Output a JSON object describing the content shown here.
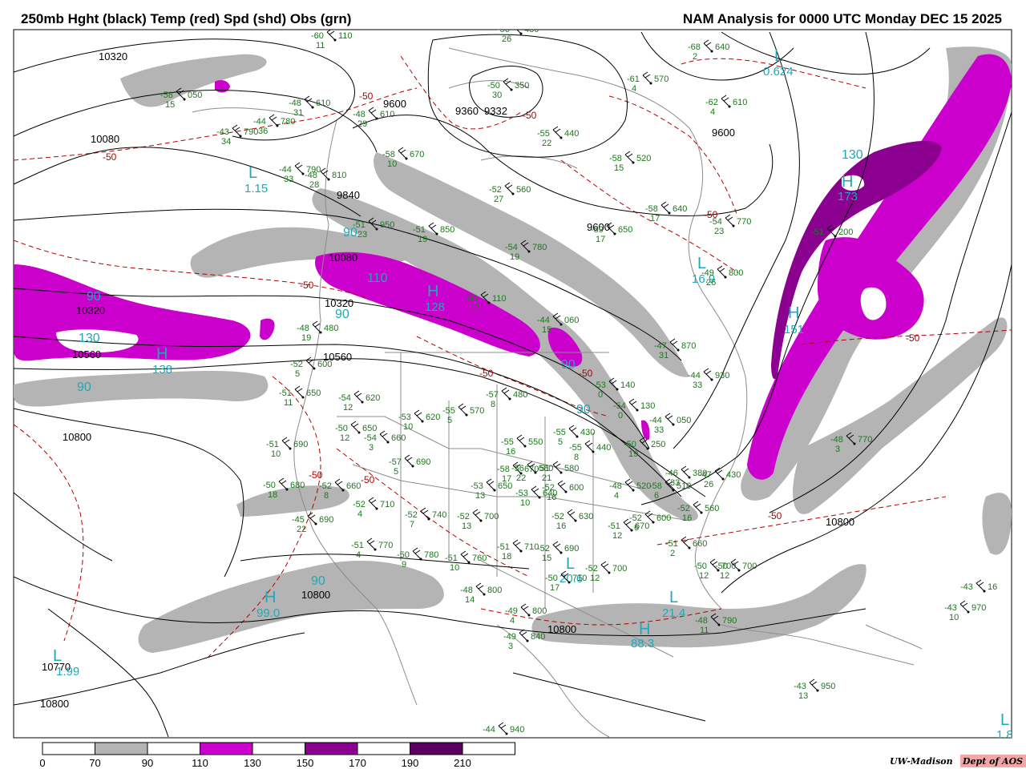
{
  "header": {
    "left_title": "250mb Hght (black) Temp (red) Spd (shd) Obs (grn)",
    "right_title": "NAM Analysis for 0000 UTC Monday  DEC 15 2025"
  },
  "colors": {
    "speed_70_90": "#b4b4b4",
    "speed_110_130": "#cc00cc",
    "speed_150_170": "#8c0090",
    "speed_190_210": "#5a0060",
    "height_contour": "#000000",
    "temperature_contour": "#b40000",
    "observations": "#1a7a1a",
    "center_labels": "#20a8b8",
    "geography": "#8c8c8c"
  },
  "height_labels": [
    "10320",
    "10080",
    "9840",
    "9600",
    "9360",
    "9332",
    "9600",
    "9600",
    "10080",
    "10320",
    "10560",
    "10800",
    "10320",
    "10560",
    "10800",
    "10800",
    "10770",
    "10800",
    "10800"
  ],
  "temp_labels": [
    "-50",
    "-50",
    "-50",
    "-50",
    "-50",
    "-50",
    "-50",
    "-50",
    "-50",
    "-50",
    "-50"
  ],
  "centers": [
    {
      "letter": "H",
      "value": "173"
    },
    {
      "letter": "H",
      "value": "128"
    },
    {
      "letter": "H",
      "value": "138"
    },
    {
      "letter": "H",
      "value": "99.0"
    },
    {
      "letter": "H",
      "value": "88.3"
    },
    {
      "letter": "H",
      "value": "151"
    },
    {
      "letter": "L",
      "value": "1.15"
    },
    {
      "letter": "L",
      "value": "0.624"
    },
    {
      "letter": "L",
      "value": "16.9"
    },
    {
      "letter": "L",
      "value": "21.4"
    },
    {
      "letter": "L",
      "value": "20.6"
    },
    {
      "letter": "L",
      "value": "1.99"
    },
    {
      "letter": "L",
      "value": "1.8"
    }
  ],
  "speed_labels": [
    "90",
    "90",
    "130",
    "90",
    "90",
    "90",
    "90",
    "130",
    "90",
    "110"
  ],
  "observations": [
    {
      "temp": "-60",
      "hgt": "110",
      "dpd": "11"
    },
    {
      "temp": "-56",
      "hgt": "430",
      "dpd": "26"
    },
    {
      "temp": "-58",
      "hgt": "050",
      "dpd": "15"
    },
    {
      "temp": "-48",
      "hgt": "610",
      "dpd": "31"
    },
    {
      "temp": "-44",
      "hgt": "780",
      "dpd": "36"
    },
    {
      "temp": "-43",
      "hgt": "790",
      "dpd": "34"
    },
    {
      "temp": "-48",
      "hgt": "610",
      "dpd": "29"
    },
    {
      "temp": "-50",
      "hgt": "350",
      "dpd": "30"
    },
    {
      "temp": "-68",
      "hgt": "640",
      "dpd": "2"
    },
    {
      "temp": "-61",
      "hgt": "570",
      "dpd": "4"
    },
    {
      "temp": "-62",
      "hgt": "610",
      "dpd": "4"
    },
    {
      "temp": "-55",
      "hgt": "440",
      "dpd": "22"
    },
    {
      "temp": "-58",
      "hgt": "670",
      "dpd": "10"
    },
    {
      "temp": "-58",
      "hgt": "520",
      "dpd": "15"
    },
    {
      "temp": "-44",
      "hgt": "790",
      "dpd": "33"
    },
    {
      "temp": "-48",
      "hgt": "810",
      "dpd": "28"
    },
    {
      "temp": "-52",
      "hgt": "560",
      "dpd": "27"
    },
    {
      "temp": "-58",
      "hgt": "640",
      "dpd": "17"
    },
    {
      "temp": "-54",
      "hgt": "770",
      "dpd": "23"
    },
    {
      "temp": "-51",
      "hgt": "950",
      "dpd": "23"
    },
    {
      "temp": "-51",
      "hgt": "850",
      "dpd": "19"
    },
    {
      "temp": "-59",
      "hgt": "650",
      "dpd": "17"
    },
    {
      "temp": "-54",
      "hgt": "780",
      "dpd": "19"
    },
    {
      "temp": "-49",
      "hgt": "800",
      "dpd": "26"
    },
    {
      "temp": "-51",
      "hgt": "200",
      "dpd": ""
    },
    {
      "temp": "-55",
      "hgt": "110",
      "dpd": "17"
    },
    {
      "temp": "-48",
      "hgt": "480",
      "dpd": "19"
    },
    {
      "temp": "-52",
      "hgt": "600",
      "dpd": "5"
    },
    {
      "temp": "-47",
      "hgt": "870",
      "dpd": "31"
    },
    {
      "temp": "-44",
      "hgt": "930",
      "dpd": "33"
    },
    {
      "temp": "-51",
      "hgt": "650",
      "dpd": "11"
    },
    {
      "temp": "-54",
      "hgt": "620",
      "dpd": "12"
    },
    {
      "temp": "-53",
      "hgt": "620",
      "dpd": "10"
    },
    {
      "temp": "-55",
      "hgt": "570",
      "dpd": "5"
    },
    {
      "temp": "-57",
      "hgt": "480",
      "dpd": "8"
    },
    {
      "temp": "-50",
      "hgt": "650",
      "dpd": "12"
    },
    {
      "temp": "-54",
      "hgt": "660",
      "dpd": "3"
    },
    {
      "temp": "-51",
      "hgt": "690",
      "dpd": "10"
    },
    {
      "temp": "-57",
      "hgt": "690",
      "dpd": "5"
    },
    {
      "temp": "-50",
      "hgt": "680",
      "dpd": "18"
    },
    {
      "temp": "-52",
      "hgt": "660",
      "dpd": "8"
    },
    {
      "temp": "-52",
      "hgt": "710",
      "dpd": "4"
    },
    {
      "temp": "-45",
      "hgt": "690",
      "dpd": "22"
    },
    {
      "temp": "-52",
      "hgt": "740",
      "dpd": "7"
    },
    {
      "temp": "-52",
      "hgt": "700",
      "dpd": "13"
    },
    {
      "temp": "-51",
      "hgt": "770",
      "dpd": "4"
    },
    {
      "temp": "-50",
      "hgt": "780",
      "dpd": "9"
    },
    {
      "temp": "-51",
      "hgt": "760",
      "dpd": "10"
    },
    {
      "temp": "-51",
      "hgt": "710",
      "dpd": "18"
    },
    {
      "temp": "-52",
      "hgt": "690",
      "dpd": "15"
    },
    {
      "temp": "-51",
      "hgt": "670",
      "dpd": "12"
    },
    {
      "temp": "-52",
      "hgt": "630",
      "dpd": "16"
    },
    {
      "temp": "-53",
      "hgt": "640",
      "dpd": "10"
    },
    {
      "temp": "-52",
      "hgt": "600",
      "dpd": "16"
    },
    {
      "temp": "-53",
      "hgt": "650",
      "dpd": "13"
    },
    {
      "temp": "-58",
      "hgt": "670",
      "dpd": "17"
    },
    {
      "temp": "-56",
      "hgt": "580",
      "dpd": "22"
    },
    {
      "temp": "-51",
      "hgt": "580",
      "dpd": "21"
    },
    {
      "temp": "-55",
      "hgt": "550",
      "dpd": "16"
    },
    {
      "temp": "-55",
      "hgt": "440",
      "dpd": "8"
    },
    {
      "temp": "-55",
      "hgt": "430",
      "dpd": "5"
    },
    {
      "temp": "-53",
      "hgt": "140",
      "dpd": "0"
    },
    {
      "temp": "-54",
      "hgt": "130",
      "dpd": "0"
    },
    {
      "temp": "-50",
      "hgt": "250",
      "dpd": "19"
    },
    {
      "temp": "-44",
      "hgt": "050",
      "dpd": "33"
    },
    {
      "temp": "-44",
      "hgt": "060",
      "dpd": "15"
    },
    {
      "temp": "-48",
      "hgt": "520",
      "dpd": "4"
    },
    {
      "temp": "-58",
      "hgt": "510",
      "dpd": "6"
    },
    {
      "temp": "-46",
      "hgt": "380",
      "dpd": "33"
    },
    {
      "temp": "-47",
      "hgt": "430",
      "dpd": "26"
    },
    {
      "temp": "-52",
      "hgt": "560",
      "dpd": "16"
    },
    {
      "temp": "-52",
      "hgt": "600",
      "dpd": "6"
    },
    {
      "temp": "-51",
      "hgt": "660",
      "dpd": "2"
    },
    {
      "temp": "-50",
      "hgt": "700",
      "dpd": "12"
    },
    {
      "temp": "-50",
      "hgt": "700",
      "dpd": "12"
    },
    {
      "temp": "-52",
      "hgt": "700",
      "dpd": "12"
    },
    {
      "temp": "-48",
      "hgt": "800",
      "dpd": "14"
    },
    {
      "temp": "-49",
      "hgt": "800",
      "dpd": "4"
    },
    {
      "temp": "-49",
      "hgt": "840",
      "dpd": "3"
    },
    {
      "temp": "-48",
      "hgt": "790",
      "dpd": "11"
    },
    {
      "temp": "-50",
      "hgt": "710",
      "dpd": "17"
    },
    {
      "temp": "-48",
      "hgt": "770",
      "dpd": "3"
    },
    {
      "temp": "-43",
      "hgt": "970",
      "dpd": "10"
    },
    {
      "temp": "-43",
      "hgt": "16",
      "dpd": ""
    },
    {
      "temp": "-43",
      "hgt": "950",
      "dpd": "13"
    },
    {
      "temp": "-44",
      "hgt": "940",
      "dpd": ""
    }
  ],
  "colorbar": {
    "ticks": [
      "0",
      "70",
      "90",
      "110",
      "130",
      "150",
      "170",
      "190",
      "210"
    ],
    "fills": [
      "#ffffff",
      "#b4b4b4",
      "#ffffff",
      "#cc00cc",
      "#ffffff",
      "#8c0090",
      "#ffffff",
      "#5a0060",
      "#ffffff"
    ]
  },
  "credit": {
    "institution": "UW-Madison",
    "dept": "Dept of AOS"
  }
}
